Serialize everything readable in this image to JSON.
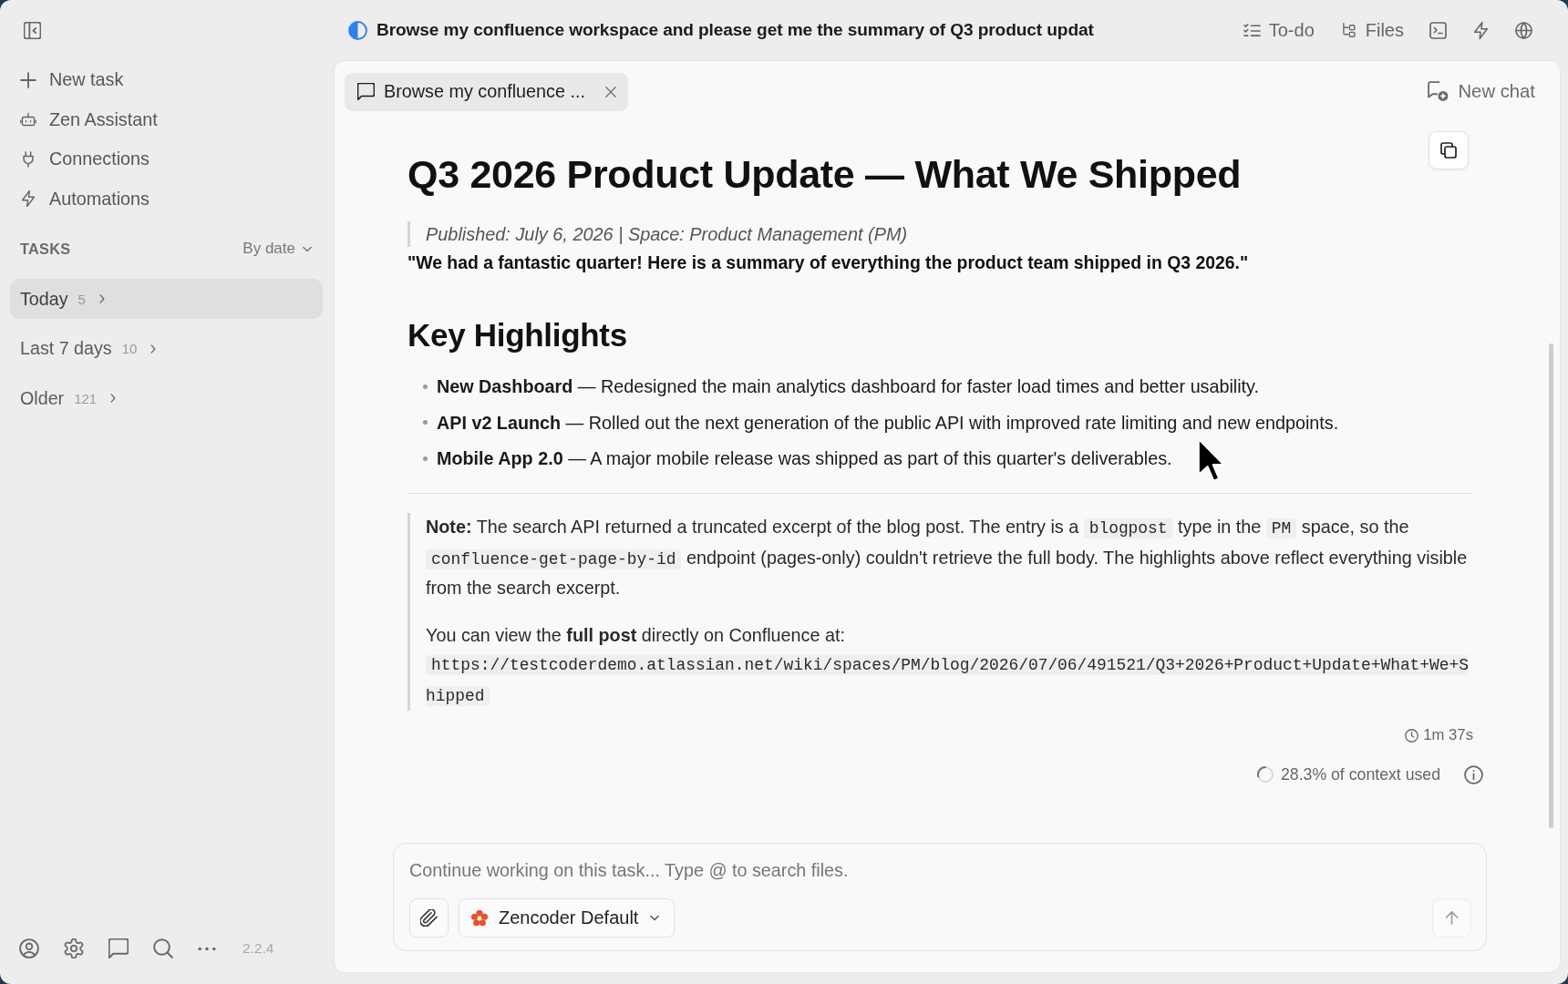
{
  "sidebar": {
    "nav_items": [
      {
        "kind": "new",
        "label": "New task"
      },
      {
        "kind": "assistant",
        "label": "Zen Assistant"
      },
      {
        "kind": "connections",
        "label": "Connections"
      },
      {
        "kind": "automations",
        "label": "Automations"
      }
    ],
    "tasks": {
      "heading": "TASKS",
      "sort": "By date",
      "groups": [
        {
          "label": "Today",
          "count": "5",
          "selected": true
        },
        {
          "label": "Last 7 days",
          "count": "10",
          "selected": false
        },
        {
          "label": "Older",
          "count": "121",
          "selected": false
        }
      ]
    },
    "version": "2.2.4"
  },
  "header": {
    "task_title": "Browse my confluence workspace and please get me the summary of Q3 product updat",
    "actions": [
      {
        "kind": "todo",
        "label": "To-do"
      },
      {
        "kind": "files",
        "label": "Files"
      }
    ]
  },
  "tabs": [
    {
      "label": "Browse my confluence ...",
      "selected": true
    }
  ],
  "new_chat": "New chat",
  "message": {
    "title": "Q3 2026 Product Update — What We Shipped",
    "meta": "Published: July 6, 2026 | Space: Product Management (PM)",
    "intro": "\"We had a fantastic quarter! Here is a summary of everything the product team shipped in Q3 2026.\"",
    "section_heading": "Key Highlights",
    "highlights": [
      "**New Dashboard** — Redesigned the main analytics dashboard for faster load times and better usability.",
      "**API v2 Launch** — Rolled out the next generation of the public API with improved rate limiting and new endpoints.",
      "**Mobile App 2.0** — A major mobile release was shipped as part of this quarter's deliverables."
    ],
    "note": [
      [
        {
          "kind": "text",
          "text": "**Note:** The search API returned a truncated excerpt of the blog post. The entry is a "
        },
        {
          "kind": "code",
          "text": "blogpost"
        },
        {
          "kind": "text",
          "text": " type in the "
        },
        {
          "kind": "code",
          "text": "PM"
        },
        {
          "kind": "text",
          "text": " space, so the "
        },
        {
          "kind": "code",
          "text": "confluence-get-page-by-id"
        },
        {
          "kind": "text",
          "text": " endpoint (pages-only) couldn't retrieve the full body. The highlights above reflect everything visible from the search excerpt."
        }
      ],
      [
        {
          "kind": "text",
          "text": "You can view the **full post** directly on Confluence at: "
        },
        {
          "kind": "code",
          "text": "https://testcoderdemo.atlassian.net/wiki/spaces/PM/blog/2026/07/06/491521/Q3+2026+Product+Update+What+We+Shipped"
        }
      ]
    ],
    "duration": "1m 37s",
    "context_usage": "28.3% of context used"
  },
  "composer": {
    "placeholder": "Continue working on this task... Type @ to search files.",
    "model": "Zencoder Default"
  }
}
